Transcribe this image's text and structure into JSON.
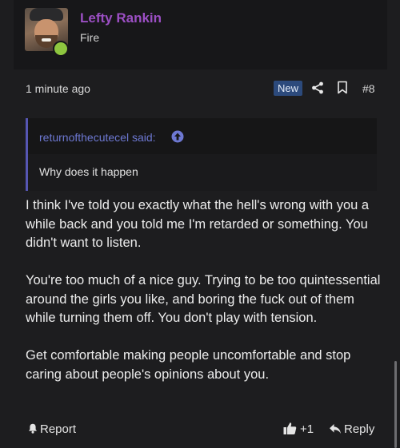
{
  "user": {
    "name": "Lefty Rankin",
    "title": "Fire",
    "name_color": "#9c4fc4",
    "online_color": "#8ec63f"
  },
  "meta": {
    "time": "1 minute ago",
    "badge": "New",
    "post_number": "#8",
    "icons": [
      "share-icon",
      "bookmark-icon"
    ]
  },
  "quote": {
    "author": "returnofthecutecel said:",
    "text": "Why does it happen",
    "accent": "#5656b3"
  },
  "body": {
    "paragraphs": [
      "I think I've told you exactly what the hell's wrong with you a while back and you told me I'm retarded or something. You didn't want to listen.",
      "You're too much of a nice guy. Trying to be too quintessential around the girls you like, and boring the fuck out of them while turning them off. You don't play with tension.",
      "Get comfortable making people uncomfortable and stop caring about people's opinions about you."
    ]
  },
  "footer": {
    "report_label": "Report",
    "like_count": "+1",
    "reply_label": "Reply"
  }
}
